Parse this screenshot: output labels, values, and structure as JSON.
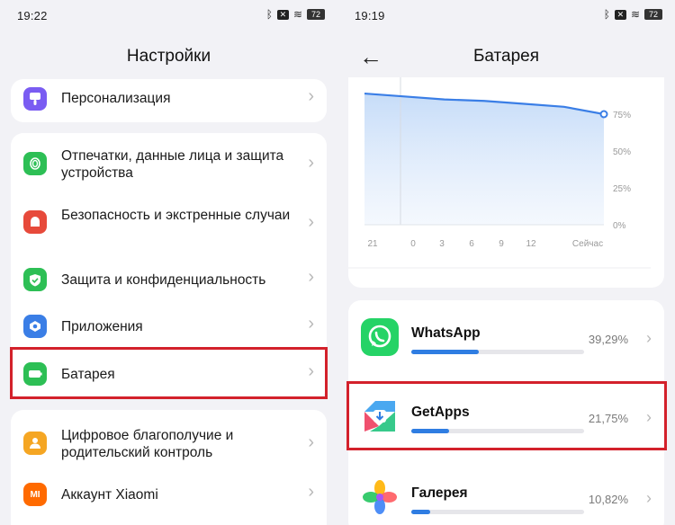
{
  "left": {
    "status": {
      "time": "19:22",
      "battery": "72"
    },
    "title": "Настройки",
    "items": [
      {
        "label": "Персонализация",
        "color": "#7a5cf2",
        "icon": "brush-icon"
      },
      {
        "label": "Отпечатки, данные лица и защита устройства",
        "color": "#2dbf55",
        "icon": "fingerprint-icon"
      },
      {
        "label": "Безопасность и экстренные случаи",
        "color": "#e74a3b",
        "icon": "emergency-icon"
      },
      {
        "label": "Защита и конфиденциальность",
        "color": "#2dbf55",
        "icon": "shield-icon"
      },
      {
        "label": "Приложения",
        "color": "#3a7ee6",
        "icon": "apps-icon"
      },
      {
        "label": "Батарея",
        "color": "#2dbf55",
        "icon": "battery-icon"
      },
      {
        "label": "Цифровое благополучие и родительский контроль",
        "color": "#f5a623",
        "icon": "wellbeing-icon"
      },
      {
        "label": "Аккаунт Xiaomi",
        "color": "#ff6a00",
        "icon": "xiaomi-icon",
        "glyph": "MI"
      }
    ]
  },
  "right": {
    "status": {
      "time": "19:19",
      "battery": "72"
    },
    "title": "Батарея",
    "chart_data": {
      "type": "area",
      "x": [
        "21",
        "0",
        "3",
        "6",
        "9",
        "12",
        "Сейчас"
      ],
      "y": [
        89,
        87,
        85,
        84,
        82,
        80,
        75
      ],
      "yticks": [
        "75%",
        "50%",
        "25%",
        "0%"
      ],
      "ylim": [
        0,
        100
      ],
      "color": "#3a7ee6"
    },
    "apps": [
      {
        "name": "WhatsApp",
        "percent": "39,29%",
        "fraction": 0.3929,
        "icon": "whatsapp-icon"
      },
      {
        "name": "GetApps",
        "percent": "21,75%",
        "fraction": 0.2175,
        "icon": "getapps-icon"
      },
      {
        "name": "Галерея",
        "percent": "10,82%",
        "fraction": 0.1082,
        "icon": "gallery-icon"
      }
    ]
  }
}
